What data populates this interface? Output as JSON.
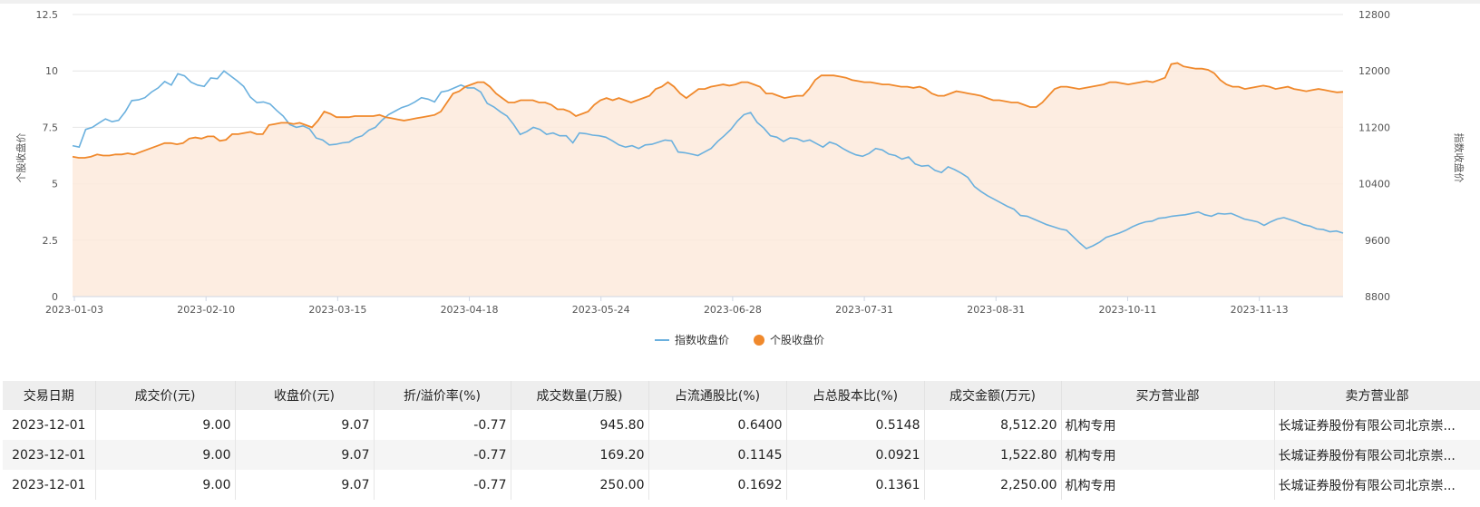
{
  "chart_data": {
    "type": "line",
    "x_ticks": [
      "2023-01-03",
      "2023-02-10",
      "2023-03-15",
      "2023-04-18",
      "2023-05-24",
      "2023-06-28",
      "2023-07-31",
      "2023-08-31",
      "2023-10-11",
      "2023-11-13"
    ],
    "y_left": {
      "label": "个股收盘价",
      "range": [
        0,
        12.5
      ],
      "ticks": [
        "0",
        "2.5",
        "5",
        "7.5",
        "10",
        "12.5"
      ]
    },
    "y_right": {
      "label": "指数收盘价",
      "range": [
        8800,
        12800
      ],
      "ticks": [
        "8800",
        "9600",
        "10400",
        "11200",
        "12000",
        "12800"
      ]
    },
    "grid": true,
    "legend": {
      "position": "bottom-center"
    },
    "series": [
      {
        "name": "指数收盘价",
        "axis": "right",
        "color": "#6ab0de",
        "values": [
          10940,
          10920,
          11170,
          11200,
          11260,
          11320,
          11280,
          11300,
          11420,
          11580,
          11590,
          11620,
          11700,
          11760,
          11850,
          11800,
          11960,
          11930,
          11840,
          11800,
          11780,
          11900,
          11890,
          12000,
          11930,
          11860,
          11780,
          11630,
          11550,
          11560,
          11530,
          11440,
          11360,
          11240,
          11200,
          11220,
          11180,
          11050,
          11020,
          10950,
          10960,
          10980,
          10990,
          11050,
          11080,
          11160,
          11200,
          11300,
          11380,
          11430,
          11480,
          11510,
          11560,
          11620,
          11600,
          11560,
          11700,
          11720,
          11760,
          11800,
          11760,
          11760,
          11700,
          11540,
          11490,
          11420,
          11360,
          11240,
          11100,
          11140,
          11200,
          11170,
          11100,
          11120,
          11080,
          11080,
          10980,
          11120,
          11110,
          11090,
          11080,
          11060,
          11010,
          10950,
          10920,
          10940,
          10900,
          10950,
          10960,
          10990,
          11020,
          11010,
          10850,
          10840,
          10820,
          10800,
          10850,
          10900,
          11000,
          11080,
          11170,
          11290,
          11380,
          11410,
          11270,
          11190,
          11080,
          11060,
          11000,
          11050,
          11040,
          11000,
          11020,
          10970,
          10920,
          10990,
          10960,
          10900,
          10850,
          10810,
          10790,
          10830,
          10900,
          10880,
          10820,
          10800,
          10750,
          10780,
          10680,
          10650,
          10660,
          10590,
          10560,
          10640,
          10600,
          10550,
          10490,
          10360,
          10290,
          10230,
          10180,
          10130,
          10080,
          10040,
          9950,
          9940,
          9900,
          9860,
          9820,
          9790,
          9760,
          9740,
          9650,
          9560,
          9480,
          9520,
          9570,
          9640,
          9670,
          9700,
          9740,
          9790,
          9830,
          9860,
          9870,
          9910,
          9920,
          9940,
          9950,
          9960,
          9980,
          10000,
          9960,
          9940,
          9980,
          9970,
          9980,
          9940,
          9900,
          9880,
          9860,
          9810,
          9860,
          9900,
          9920,
          9890,
          9860,
          9820,
          9800,
          9760,
          9750,
          9720,
          9730,
          9700
        ]
      },
      {
        "name": "个股收盘价",
        "axis": "left",
        "color": "#f0892c",
        "values": [
          6.2,
          6.15,
          6.15,
          6.2,
          6.3,
          6.25,
          6.25,
          6.3,
          6.3,
          6.35,
          6.3,
          6.4,
          6.5,
          6.6,
          6.7,
          6.8,
          6.8,
          6.75,
          6.8,
          7.0,
          7.05,
          7.0,
          7.1,
          7.1,
          6.9,
          6.95,
          7.2,
          7.2,
          7.25,
          7.3,
          7.2,
          7.2,
          7.6,
          7.65,
          7.7,
          7.7,
          7.65,
          7.7,
          7.6,
          7.5,
          7.8,
          8.2,
          8.1,
          7.95,
          7.95,
          7.95,
          8.0,
          8.0,
          8.0,
          8.0,
          8.05,
          7.95,
          7.9,
          7.85,
          7.8,
          7.85,
          7.9,
          7.95,
          8.0,
          8.05,
          8.2,
          8.6,
          9.0,
          9.1,
          9.3,
          9.4,
          9.5,
          9.5,
          9.3,
          9.0,
          8.8,
          8.6,
          8.6,
          8.7,
          8.7,
          8.7,
          8.6,
          8.6,
          8.5,
          8.3,
          8.3,
          8.2,
          8.0,
          8.1,
          8.2,
          8.5,
          8.7,
          8.8,
          8.7,
          8.8,
          8.7,
          8.6,
          8.7,
          8.8,
          8.9,
          9.2,
          9.3,
          9.5,
          9.3,
          9.0,
          8.8,
          9.0,
          9.2,
          9.2,
          9.3,
          9.35,
          9.4,
          9.35,
          9.4,
          9.5,
          9.5,
          9.4,
          9.3,
          9.0,
          9.0,
          8.9,
          8.8,
          8.85,
          8.9,
          8.9,
          9.2,
          9.6,
          9.8,
          9.8,
          9.8,
          9.75,
          9.7,
          9.6,
          9.55,
          9.5,
          9.5,
          9.45,
          9.4,
          9.4,
          9.35,
          9.3,
          9.3,
          9.25,
          9.3,
          9.2,
          9.0,
          8.9,
          8.9,
          9.0,
          9.1,
          9.05,
          9.0,
          8.95,
          8.9,
          8.8,
          8.7,
          8.7,
          8.65,
          8.6,
          8.6,
          8.5,
          8.4,
          8.4,
          8.6,
          8.9,
          9.2,
          9.3,
          9.3,
          9.25,
          9.2,
          9.25,
          9.3,
          9.35,
          9.4,
          9.5,
          9.5,
          9.45,
          9.4,
          9.45,
          9.5,
          9.55,
          9.5,
          9.6,
          9.7,
          10.3,
          10.35,
          10.2,
          10.15,
          10.1,
          10.1,
          10.05,
          9.9,
          9.6,
          9.4,
          9.3,
          9.3,
          9.2,
          9.25,
          9.3,
          9.35,
          9.3,
          9.2,
          9.25,
          9.3,
          9.2,
          9.15,
          9.1,
          9.15,
          9.2,
          9.15,
          9.1,
          9.05,
          9.07
        ]
      }
    ]
  },
  "legend": {
    "items": [
      {
        "label": "指数收盘价",
        "color": "#6ab0de"
      },
      {
        "label": "个股收盘价",
        "color": "#f0892c"
      }
    ]
  },
  "table": {
    "headers": [
      "交易日期",
      "成交价(元)",
      "收盘价(元)",
      "折/溢价率(%)",
      "成交数量(万股)",
      "占流通股比(%)",
      "占总股本比(%)",
      "成交金额(万元)",
      "买方营业部",
      "卖方营业部"
    ],
    "rows": [
      [
        "2023-12-01",
        "9.00",
        "9.07",
        "-0.77",
        "945.80",
        "0.6400",
        "0.5148",
        "8,512.20",
        "机构专用",
        "长城证券股份有限公司北京崇..."
      ],
      [
        "2023-12-01",
        "9.00",
        "9.07",
        "-0.77",
        "169.20",
        "0.1145",
        "0.0921",
        "1,522.80",
        "机构专用",
        "长城证券股份有限公司北京崇..."
      ],
      [
        "2023-12-01",
        "9.00",
        "9.07",
        "-0.77",
        "250.00",
        "0.1692",
        "0.1361",
        "2,250.00",
        "机构专用",
        "长城证券股份有限公司北京崇..."
      ]
    ]
  }
}
